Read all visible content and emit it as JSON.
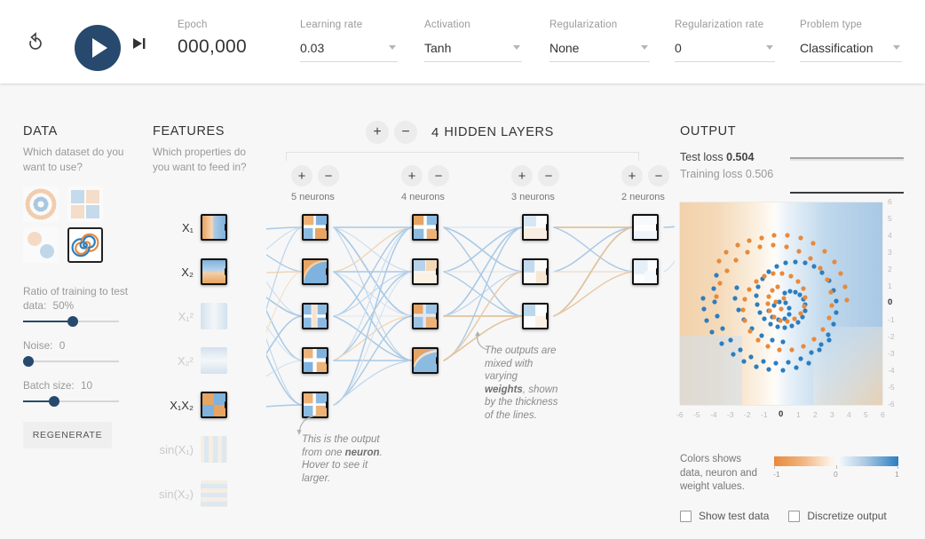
{
  "header": {
    "controls": {
      "reset_label": "reset-icon",
      "play_label": "play-icon",
      "step_label": "step-icon"
    },
    "fields": [
      {
        "label": "Epoch",
        "value": "000,000",
        "type": "readout"
      },
      {
        "label": "Learning rate",
        "value": "0.03",
        "type": "select"
      },
      {
        "label": "Activation",
        "value": "Tanh",
        "type": "select"
      },
      {
        "label": "Regularization",
        "value": "None",
        "type": "select"
      },
      {
        "label": "Regularization rate",
        "value": "0",
        "type": "select"
      },
      {
        "label": "Problem type",
        "value": "Classification",
        "type": "select"
      }
    ]
  },
  "data_panel": {
    "title": "DATA",
    "question": "Which dataset do you want to use?",
    "datasets": [
      {
        "name": "circle",
        "selected": false
      },
      {
        "name": "exclusive-or",
        "selected": false
      },
      {
        "name": "gaussian",
        "selected": false
      },
      {
        "name": "spiral",
        "selected": true
      }
    ],
    "sliders": [
      {
        "label": "Ratio of training to test data:",
        "value": "50%",
        "fill": 52
      },
      {
        "label": "Noise:",
        "value": "0",
        "fill": 3
      },
      {
        "label": "Batch size:",
        "value": "10",
        "fill": 32
      }
    ],
    "regenerate_label": "REGENERATE"
  },
  "features_panel": {
    "title": "FEATURES",
    "question": "Which properties do you want to feed in?",
    "features": [
      {
        "label": "X₁",
        "active": true
      },
      {
        "label": "X₂",
        "active": true
      },
      {
        "label": "X₁²",
        "active": false
      },
      {
        "label": "X₂²",
        "active": false
      },
      {
        "label": "X₁X₂",
        "active": true
      },
      {
        "label": "sin(X₁)",
        "active": false
      },
      {
        "label": "sin(X₂)",
        "active": false
      }
    ]
  },
  "network": {
    "add_layer_label": "+",
    "remove_layer_label": "−",
    "layer_count": "4",
    "hidden_layers_label": "HIDDEN LAYERS",
    "layers": [
      {
        "neurons": 5,
        "count_label": "5 neurons"
      },
      {
        "neurons": 4,
        "count_label": "4 neurons"
      },
      {
        "neurons": 3,
        "count_label": "3 neurons"
      },
      {
        "neurons": 2,
        "count_label": "2 neurons"
      }
    ],
    "annotations": [
      {
        "name": "neuron-output-annotation",
        "text": "This is the output from one neuron. Hover to see it larger.",
        "bold": "neuron"
      },
      {
        "name": "weights-annotation",
        "text": "The outputs are mixed with varying weights, shown by the thickness of the lines.",
        "bold": "weights"
      }
    ]
  },
  "output_panel": {
    "title": "OUTPUT",
    "test_loss_label": "Test loss",
    "test_loss_value": "0.504",
    "training_loss_label": "Training loss",
    "training_loss_value": "0.506",
    "x_ticks": [
      "-6",
      "-5",
      "-4",
      "-3",
      "-2",
      "-1",
      "0",
      "1",
      "2",
      "3",
      "4",
      "5",
      "6"
    ],
    "y_ticks": [
      "6",
      "5",
      "4",
      "3",
      "2",
      "1",
      "0",
      "-1",
      "-2",
      "-3",
      "-4",
      "-5",
      "-6"
    ],
    "legend_text": "Colors shows data, neuron and weight values.",
    "legend_ticks": [
      "-1",
      "0",
      "1"
    ],
    "checkboxes": [
      {
        "label": "Show test data",
        "checked": false
      },
      {
        "label": "Discretize output",
        "checked": false
      }
    ]
  },
  "colors": {
    "positive": "#2a7ec0",
    "negative": "#e8893b",
    "accent": "#27496d",
    "background": "#f7f7f7",
    "header_background": "#ffffff"
  },
  "chart_data": {
    "type": "scatter",
    "title": "OUTPUT",
    "xlabel": "",
    "ylabel": "",
    "xlim": [
      -6,
      6
    ],
    "ylim": [
      -6,
      6
    ],
    "grid": false,
    "legend": "bottom",
    "series": [
      {
        "name": "positive-class",
        "color": "#2a7ec0",
        "point_count": 120
      },
      {
        "name": "negative-class",
        "color": "#e8893b",
        "point_count": 120
      }
    ],
    "background": "decision-boundary-heatmap",
    "loss_curve": {
      "type": "line",
      "series": [
        {
          "name": "Test loss",
          "color": "#777777",
          "values": [
            0.504,
            0.504
          ]
        },
        {
          "name": "Training loss",
          "color": "#222222",
          "values": [
            0.506,
            0.506
          ]
        }
      ]
    }
  }
}
